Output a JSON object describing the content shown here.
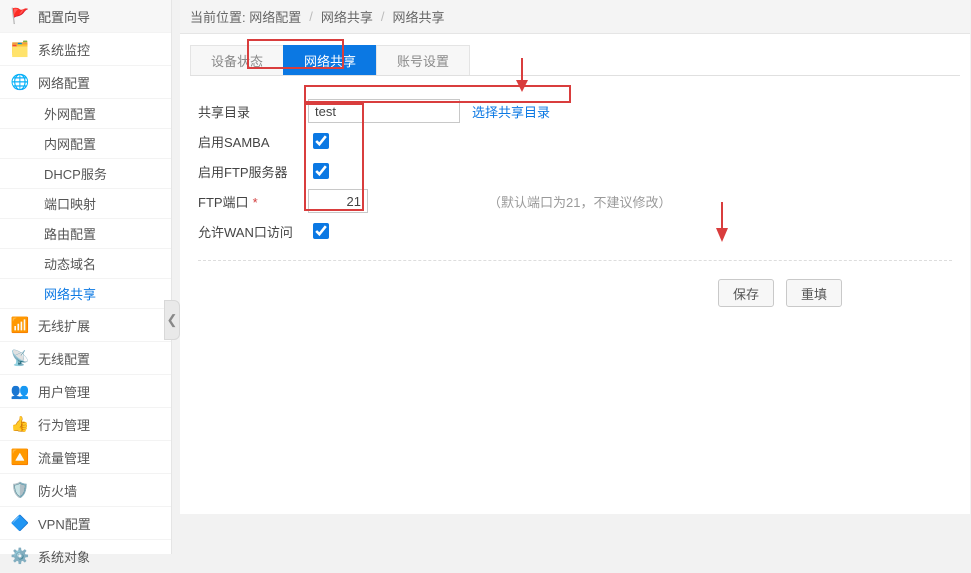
{
  "sidebar": {
    "items": [
      {
        "label": "配置向导",
        "icon": "🚩"
      },
      {
        "label": "系统监控",
        "icon": "🗂️"
      },
      {
        "label": "网络配置",
        "icon": "🌐",
        "open": true,
        "subs": [
          {
            "label": "外网配置"
          },
          {
            "label": "内网配置"
          },
          {
            "label": "DHCP服务"
          },
          {
            "label": "端口映射"
          },
          {
            "label": "路由配置"
          },
          {
            "label": "动态域名"
          },
          {
            "label": "网络共享",
            "active": true
          }
        ]
      },
      {
        "label": "无线扩展",
        "icon": "📶"
      },
      {
        "label": "无线配置",
        "icon": "📡"
      },
      {
        "label": "用户管理",
        "icon": "👥"
      },
      {
        "label": "行为管理",
        "icon": "👍"
      },
      {
        "label": "流量管理",
        "icon": "🔼"
      },
      {
        "label": "防火墙",
        "icon": "🛡️"
      },
      {
        "label": "VPN配置",
        "icon": "🔷"
      },
      {
        "label": "系统对象",
        "icon": "⚙️"
      }
    ]
  },
  "breadcrumb": {
    "prefix": "当前位置:",
    "parts": [
      "网络配置",
      "网络共享",
      "网络共享"
    ]
  },
  "tabs": [
    {
      "label": "设备状态",
      "active": false
    },
    {
      "label": "网络共享",
      "active": true
    },
    {
      "label": "账号设置",
      "active": false
    }
  ],
  "form": {
    "share_dir_label": "共享目录",
    "share_dir_value": "test",
    "select_share_dir": "选择共享目录",
    "enable_samba_label": "启用SAMBA",
    "enable_samba_checked": true,
    "enable_ftp_label": "启用FTP服务器",
    "enable_ftp_checked": true,
    "ftp_port_label": "FTP端口",
    "ftp_port_value": "21",
    "ftp_port_hint": "（默认端口为21，不建议修改）",
    "allow_wan_label": "允许WAN口访问",
    "allow_wan_checked": true
  },
  "buttons": {
    "save": "保存",
    "reset": "重填"
  }
}
